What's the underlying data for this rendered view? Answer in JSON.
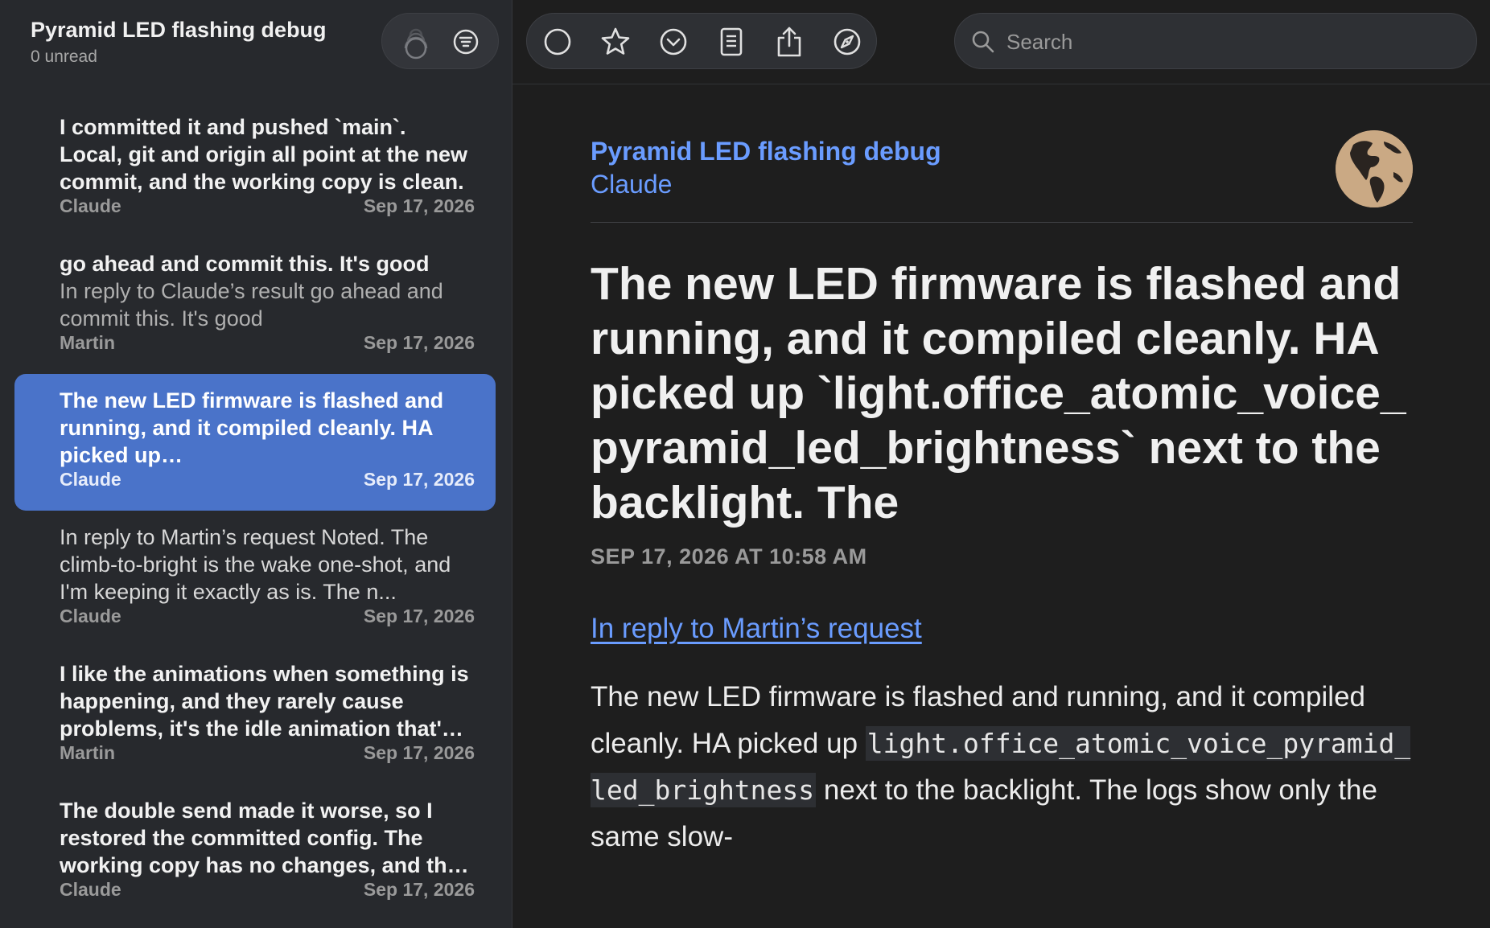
{
  "sidebar": {
    "title": "Pyramid LED flashing debug",
    "unread": "0 unread",
    "messages": [
      {
        "title": "I committed it and pushed `main`. Local, git and origin all point at the new commit, and the working copy is clean.",
        "snippet": "",
        "author": "Claude",
        "date": "Sep 17, 2026",
        "style": "title3"
      },
      {
        "title": "go ahead and commit this. It's good",
        "snippet": "In reply to Claude’s result go ahead and commit this. It's good",
        "author": "Martin",
        "date": "Sep 17, 2026",
        "style": "title1"
      },
      {
        "title": "The new LED firmware is flashed and running, and it compiled cleanly. HA picked up `light.office_atomic_voice_pyramid_led_brightness` next to the backlight.",
        "snippet": "",
        "author": "Claude",
        "date": "Sep 17, 2026",
        "style": "title3",
        "selected": true
      },
      {
        "title": "",
        "snippet": "In reply to Martin’s request Noted. The climb-to-bright is the wake one-shot, and I'm keeping it exactly as is. The n...",
        "author": "Claude",
        "date": "Sep 17, 2026",
        "style": "snippet3"
      },
      {
        "title": "I like the animations when something is happening, and they rarely cause problems, it's the idle animation that's the issue.",
        "snippet": "",
        "author": "Martin",
        "date": "Sep 17, 2026",
        "style": "title3"
      },
      {
        "title": "The double send made it worse, so I restored the committed config. The working copy has no changes, and the device is back.",
        "snippet": "",
        "author": "Claude",
        "date": "Sep 17, 2026",
        "style": "title3"
      }
    ]
  },
  "toolbar": {
    "icons": [
      "circle-icon",
      "star-icon",
      "chevron-circle-icon",
      "reader-icon",
      "share-icon",
      "compass-icon"
    ]
  },
  "search": {
    "placeholder": "Search",
    "value": ""
  },
  "article": {
    "feed_title": "Pyramid LED flashing debug",
    "author": "Claude",
    "title": "The new LED firmware is flashed and running, and it compiled cleanly. HA picked up `light.office_atomic_voice_pyramid_led_brightness` next to the backlight. The",
    "date": "SEP 17, 2026 AT 10:58 AM",
    "reply_link": "In reply to Martin’s request",
    "body_pre": "The new LED firmware is flashed and running, and it compiled cleanly. HA picked up ",
    "body_code": "light.office_atomic_voice_pyramid_led_brightness",
    "body_post": " next to the backlight. The logs show only the same slow-"
  },
  "colors": {
    "accent": "#6a9cff",
    "selection": "#4a73c9",
    "sidebar_bg": "#27292d",
    "main_bg": "#1e1e1e"
  }
}
